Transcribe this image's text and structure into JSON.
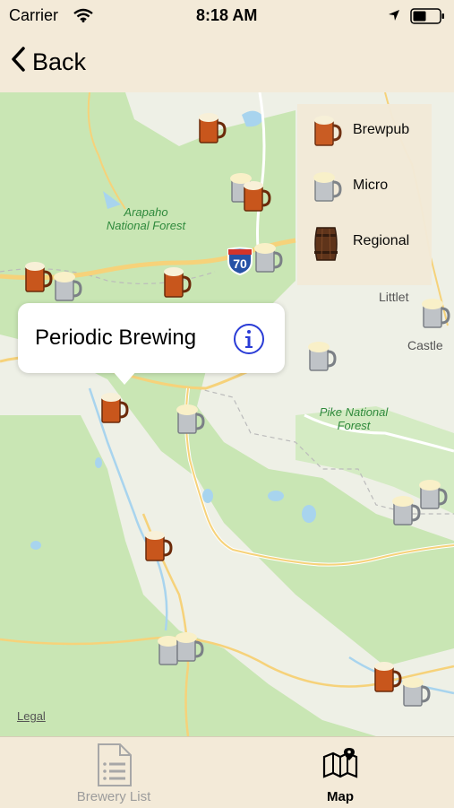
{
  "status_bar": {
    "carrier": "Carrier",
    "time": "8:18 AM"
  },
  "nav": {
    "back_label": "Back"
  },
  "map": {
    "labels": {
      "arapaho": "Arapaho\nNational Forest",
      "pike": "Pike National\nForest",
      "littleton": "Littlet",
      "castle": "Castle",
      "interstate": "70",
      "legal": "Legal"
    },
    "callout": {
      "title": "Periodic Brewing"
    },
    "legend": [
      {
        "label": "Brewpub",
        "icon": "brewpub-mug-icon"
      },
      {
        "label": "Micro",
        "icon": "micro-mug-icon"
      },
      {
        "label": "Regional",
        "icon": "regional-barrel-icon"
      }
    ]
  },
  "tabs": [
    {
      "label": "Brewery List",
      "icon": "list-document-icon",
      "selected": false
    },
    {
      "label": "Map",
      "icon": "map-icon",
      "selected": true
    }
  ],
  "colors": {
    "background": "#f3ead8",
    "forest": "#c9e6b4",
    "road": "#f6d27a",
    "water": "#a8d4ee",
    "info": "#2a3cd6"
  }
}
